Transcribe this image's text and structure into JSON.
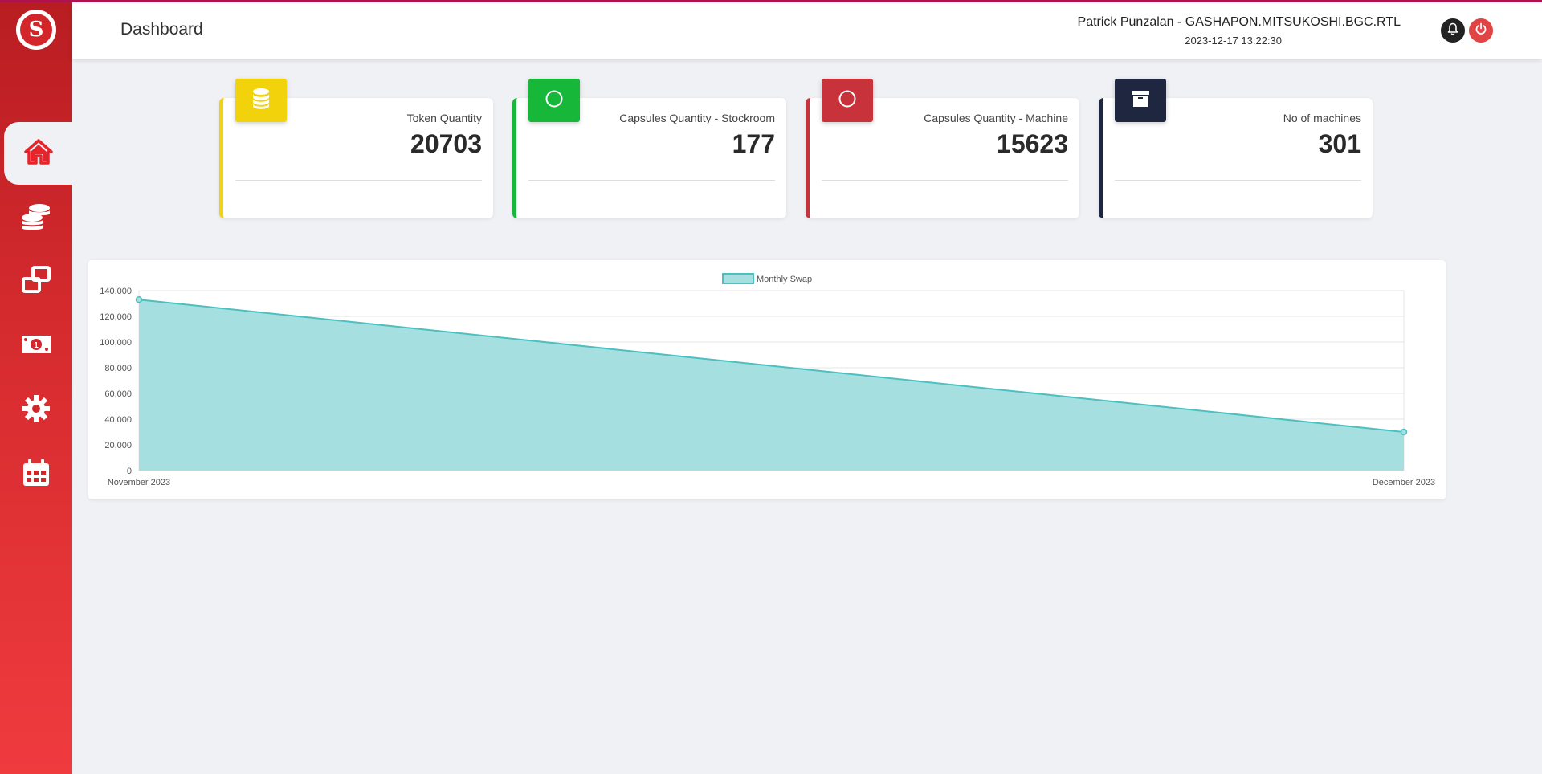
{
  "header": {
    "title": "Dashboard",
    "user": "Patrick Punzalan - GASHAPON.MITSUKOSHI.BGC.RTL",
    "datetime": "2023-12-17 13:22:30"
  },
  "sidebar": {
    "items": [
      {
        "icon": "home-icon",
        "active": true
      },
      {
        "icon": "coins-icon",
        "active": false
      },
      {
        "icon": "swap-windows-icon",
        "active": false
      },
      {
        "icon": "money-bill-icon",
        "active": false
      },
      {
        "icon": "gear-icon",
        "active": false
      },
      {
        "icon": "calendar-icon",
        "active": false
      }
    ]
  },
  "cards": [
    {
      "label": "Token Quantity",
      "value": "20703",
      "color": "#f2d20a",
      "icon": "database-icon"
    },
    {
      "label": "Capsules Quantity - Stockroom",
      "value": "177",
      "color": "#17b83a",
      "icon": "circle-icon"
    },
    {
      "label": "Capsules Quantity - Machine",
      "value": "15623",
      "color": "#c8323b",
      "icon": "circle-icon"
    },
    {
      "label": "No of machines",
      "value": "301",
      "color": "#1f2740",
      "icon": "archive-box-icon"
    }
  ],
  "colors": {
    "accent": "#d3262b",
    "chart_fill": "#a6dfdf",
    "chart_line": "#4bc0c0"
  },
  "chart_data": {
    "type": "area",
    "categories": [
      "November 2023",
      "December 2023"
    ],
    "series": [
      {
        "name": "Monthly Swap",
        "values": [
          133000,
          30000
        ]
      }
    ],
    "ylim": [
      0,
      140000
    ],
    "yticks": [
      "0",
      "20,000",
      "40,000",
      "60,000",
      "80,000",
      "100,000",
      "120,000",
      "140,000"
    ],
    "grid": true,
    "legend": "top-center"
  }
}
